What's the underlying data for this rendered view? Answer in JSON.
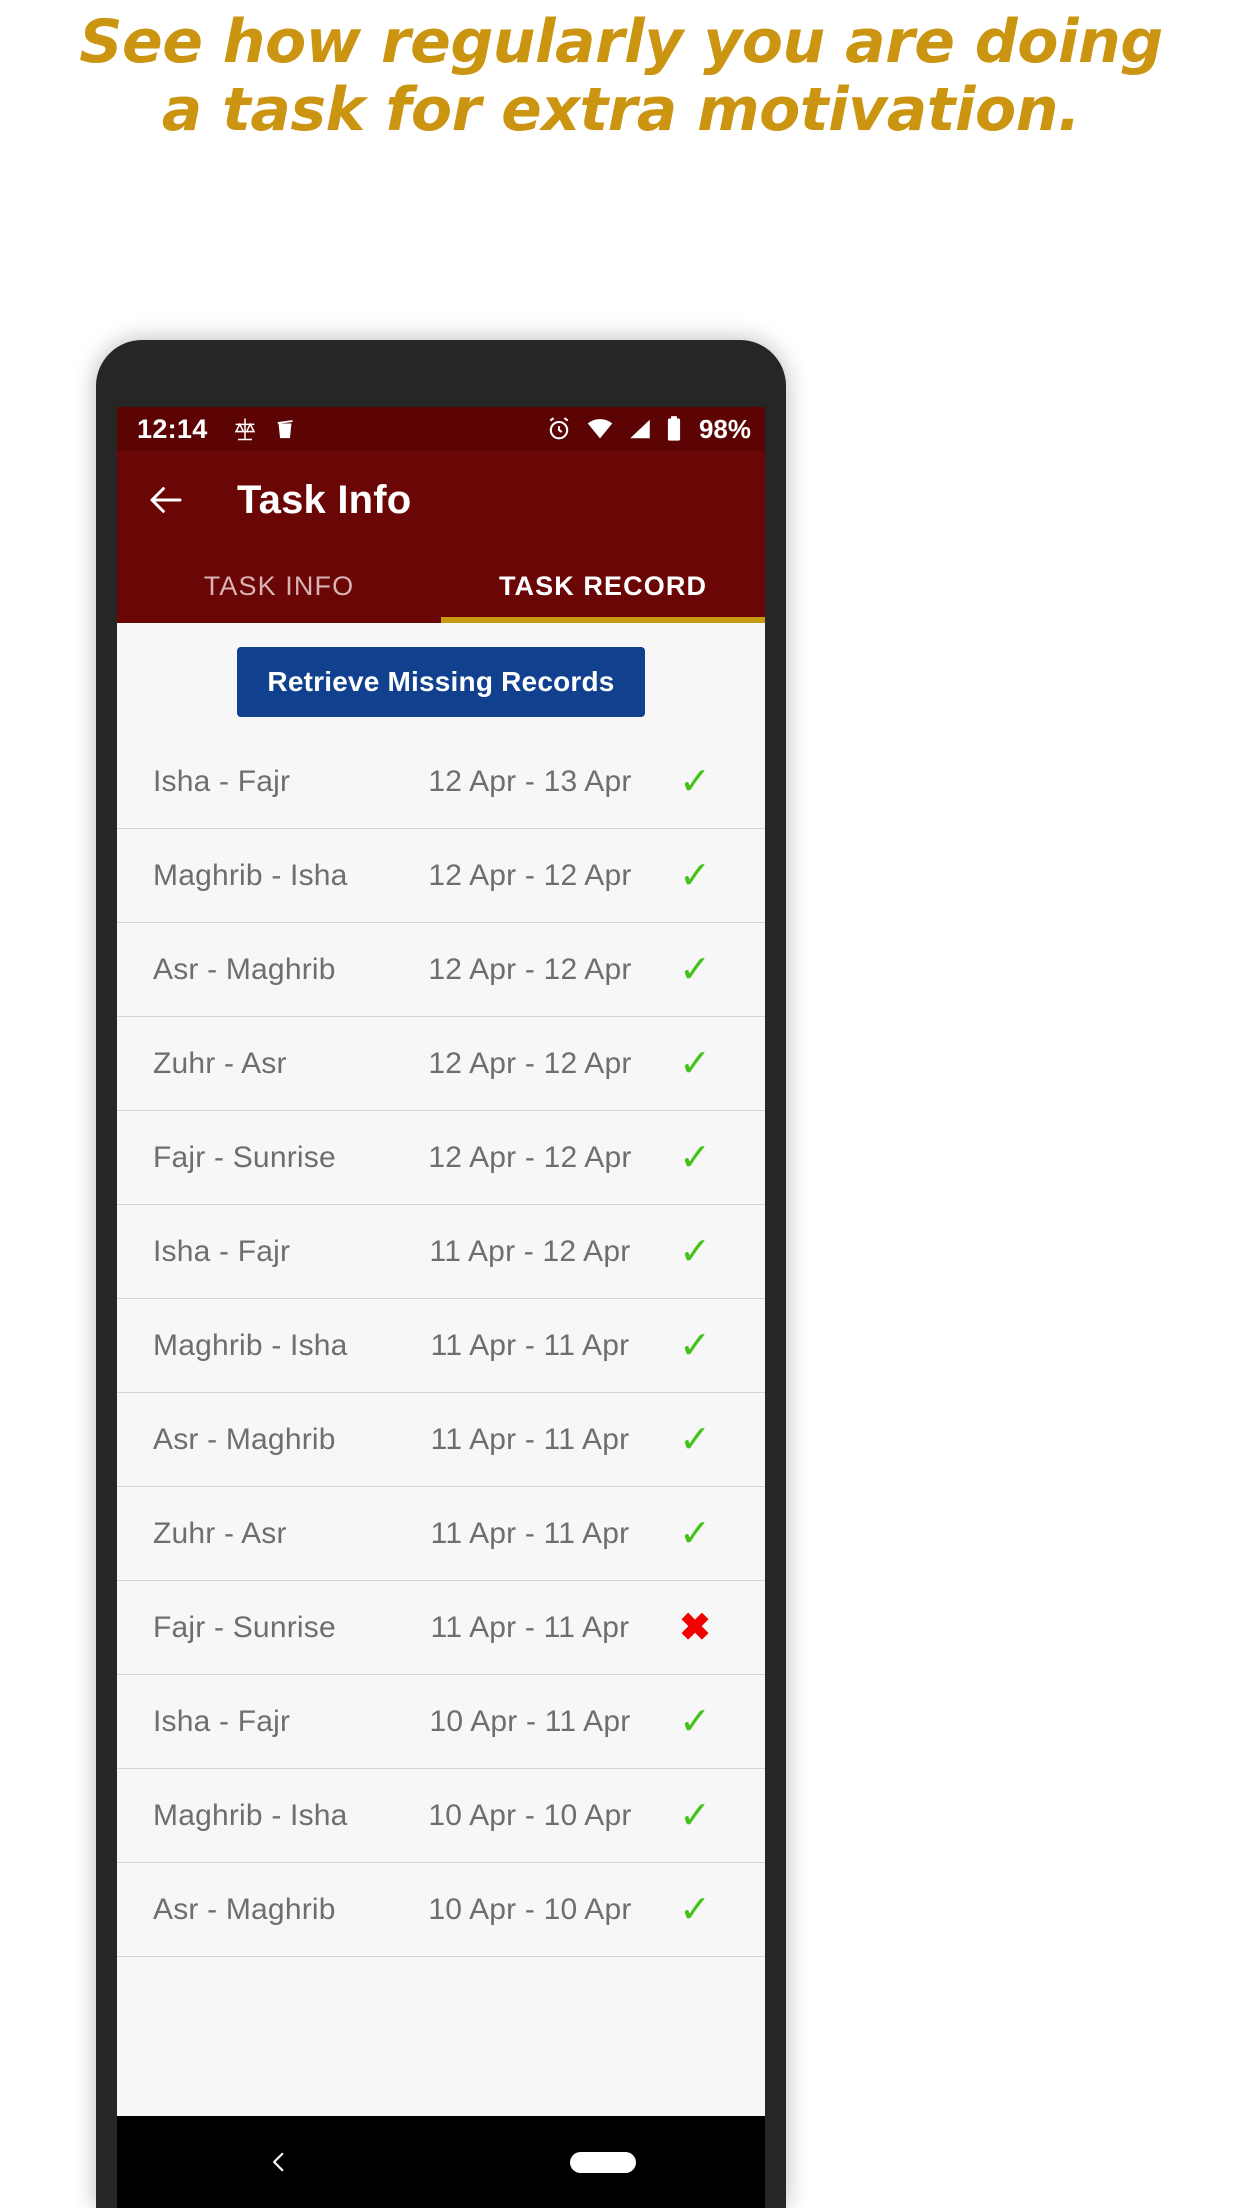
{
  "headline": "See how regularly you are doing\na task for extra motivation.",
  "colors": {
    "headline": "#CB9411",
    "statusbar_bg": "#5C0404",
    "appbar_bg": "#6B0606",
    "tab_indicator": "#C99A16",
    "button_bg": "#11408F",
    "check_green": "#44C41A",
    "cross_red": "#F20000",
    "content_bg": "#f7f7f7"
  },
  "statusbar": {
    "time": "12:14",
    "left_icons": [
      "balance-scale-icon",
      "trash-icon"
    ],
    "right_icons": [
      "alarm-icon",
      "wifi-icon",
      "signal-icon",
      "battery-icon"
    ],
    "battery_percent": "98%"
  },
  "appbar": {
    "back_icon": "back-arrow-icon",
    "title": "Task Info"
  },
  "tabs": [
    {
      "label": "TASK INFO",
      "active": false
    },
    {
      "label": "TASK RECORD",
      "active": true
    }
  ],
  "actions": {
    "retrieve_label": "Retrieve Missing Records"
  },
  "records": [
    {
      "name": "Isha - Fajr",
      "range": "12 Apr - 13 Apr",
      "status": "✓",
      "state": "ok"
    },
    {
      "name": "Maghrib - Isha",
      "range": "12 Apr - 12 Apr",
      "status": "✓",
      "state": "ok"
    },
    {
      "name": "Asr - Maghrib",
      "range": "12 Apr - 12 Apr",
      "status": "✓",
      "state": "ok"
    },
    {
      "name": "Zuhr - Asr",
      "range": "12 Apr - 12 Apr",
      "status": "✓",
      "state": "ok"
    },
    {
      "name": "Fajr - Sunrise",
      "range": "12 Apr - 12 Apr",
      "status": "✓",
      "state": "ok"
    },
    {
      "name": "Isha - Fajr",
      "range": "11 Apr - 12 Apr",
      "status": "✓",
      "state": "ok"
    },
    {
      "name": "Maghrib - Isha",
      "range": "11 Apr - 11 Apr",
      "status": "✓",
      "state": "ok"
    },
    {
      "name": "Asr - Maghrib",
      "range": "11 Apr - 11 Apr",
      "status": "✓",
      "state": "ok"
    },
    {
      "name": "Zuhr - Asr",
      "range": "11 Apr - 11 Apr",
      "status": "✓",
      "state": "ok"
    },
    {
      "name": "Fajr - Sunrise",
      "range": "11 Apr - 11 Apr",
      "status": "✖",
      "state": "fail"
    },
    {
      "name": "Isha - Fajr",
      "range": "10 Apr - 11 Apr",
      "status": "✓",
      "state": "ok"
    },
    {
      "name": "Maghrib - Isha",
      "range": "10 Apr - 10 Apr",
      "status": "✓",
      "state": "ok"
    },
    {
      "name": "Asr - Maghrib",
      "range": "10 Apr - 10 Apr",
      "status": "✓",
      "state": "ok"
    }
  ],
  "navbar": {
    "back_icon": "nav-back-chevron-icon",
    "home_icon": "nav-home-pill-icon"
  }
}
